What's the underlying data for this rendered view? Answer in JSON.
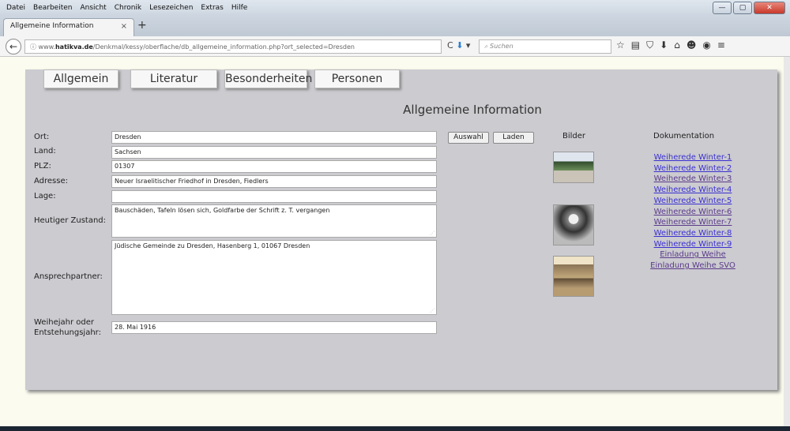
{
  "menubar": {
    "items": [
      "Datei",
      "Bearbeiten",
      "Ansicht",
      "Chronik",
      "Lesezeichen",
      "Extras",
      "Hilfe"
    ]
  },
  "window_controls": {
    "minimize": "—",
    "maximize": "▢",
    "close": "✕"
  },
  "tab": {
    "title": "Allgemeine Information",
    "close": "×",
    "new": "+"
  },
  "navbar": {
    "url_prefix": "www.",
    "url_domain": "hatikva.de",
    "url_path": "/Denkmal/kessy/oberflache/db_allgemeine_information.php?ort_selected=Dresden",
    "reload": "C",
    "search_placeholder": "Suchen"
  },
  "page": {
    "nav_tabs": [
      "Allgemein",
      "Literatur",
      "Besonderheiten",
      "Personen"
    ],
    "title": "Allgemeine Information",
    "fields": [
      {
        "label": "Ort:",
        "value": "Dresden"
      },
      {
        "label": "Land:",
        "value": "Sachsen"
      },
      {
        "label": "PLZ:",
        "value": "01307"
      },
      {
        "label": "Adresse:",
        "value": "Neuer Israelitischer Friedhof in Dresden, Fiedlers"
      },
      {
        "label": "Lage:",
        "value": ""
      },
      {
        "label": "Heutiger Zustand:",
        "value": "Bauschäden, Tafeln lösen sich, Goldfarbe der Schrift z. T. vergangen"
      },
      {
        "label": "Ansprechpartner:",
        "value": "Jüdische Gemeinde zu Dresden, Hasenberg 1, 01067 Dresden"
      },
      {
        "label": "Weihejahr oder Entstehungsjahr:",
        "value": "28. Mai 1916"
      }
    ],
    "buttons": {
      "auswahl": "Auswahl",
      "laden": "Laden"
    },
    "bilder_heading": "Bilder",
    "doc_heading": "Dokumentation",
    "doc_links": [
      "Weiherede Winter-1",
      "Weiherede Winter-2",
      "Weiherede Winter-3",
      "Weiherede Winter-4",
      "Weiherede Winter-5",
      "Weiherede Winter-6",
      "Weiherede Winter-7",
      "Weiherede Winter-8",
      "Weiherede Winter-9",
      "Einladung Weihe",
      "Einladung Weihe SVO"
    ]
  }
}
